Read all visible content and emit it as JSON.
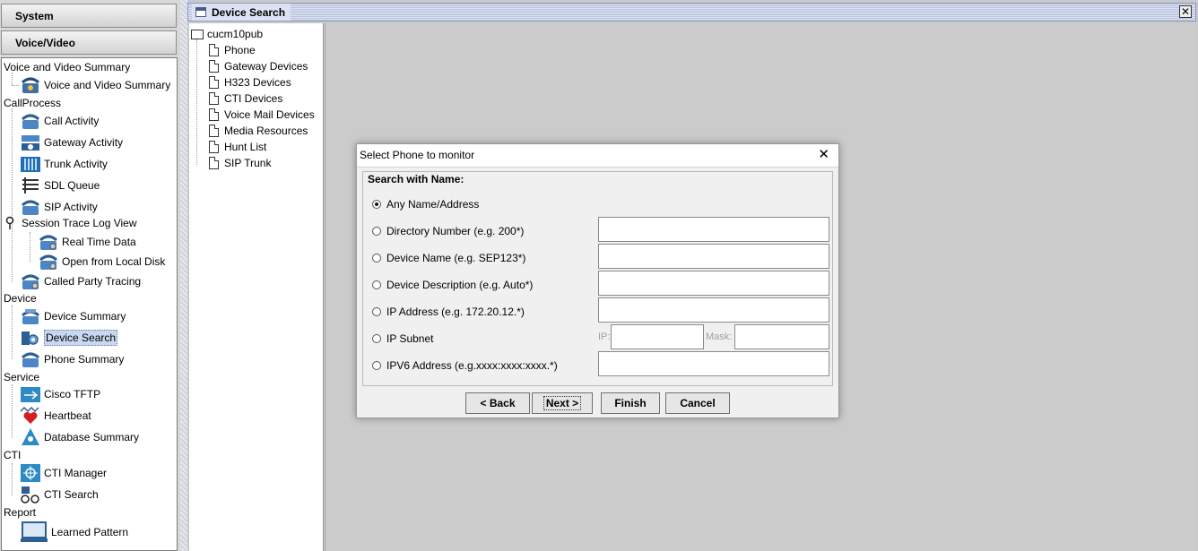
{
  "nav": {
    "system_label": "System",
    "voice_video_label": "Voice/Video"
  },
  "tree": {
    "sections": {
      "voice_video_summary": "Voice and Video Summary",
      "callprocess": "CallProcess",
      "device": "Device",
      "service": "Service",
      "cti": "CTI",
      "report": "Report"
    },
    "items": {
      "voice_video_summary": "Voice and Video Summary",
      "call_activity": "Call Activity",
      "gateway_activity": "Gateway Activity",
      "trunk_activity": "Trunk Activity",
      "sdl_queue": "SDL Queue",
      "sip_activity": "SIP Activity",
      "session_trace": "Session Trace Log View",
      "real_time_data": "Real Time Data",
      "open_local_disk": "Open from Local Disk",
      "called_party_tracing": "Called Party Tracing",
      "device_summary": "Device Summary",
      "device_search": "Device Search",
      "phone_summary": "Phone Summary",
      "cisco_tftp": "Cisco TFTP",
      "heartbeat": "Heartbeat",
      "database_summary": "Database Summary",
      "cti_manager": "CTI Manager",
      "cti_search": "CTI Search",
      "learned_pattern": "Learned Pattern"
    }
  },
  "frame": {
    "title": "Device Search",
    "close": "✕"
  },
  "device_tree": {
    "root": "cucm10pub",
    "items": [
      "Phone",
      "Gateway Devices",
      "H323 Devices",
      "CTI Devices",
      "Voice Mail Devices",
      "Media Resources",
      "Hunt List",
      "SIP Trunk"
    ]
  },
  "dialog": {
    "title": "Select Phone to monitor",
    "close": "✕",
    "group_title": "Search with Name:",
    "options": {
      "any": "Any Name/Address",
      "dn": "Directory Number (e.g. 200*)",
      "device_name": "Device Name (e.g. SEP123*)",
      "device_desc": "Device Description (e.g. Auto*)",
      "ip": "IP Address (e.g. 172.20.12.*)",
      "subnet": "IP Subnet",
      "ipv6": "IPV6 Address (e.g.xxxx:xxxx:xxxx.*)"
    },
    "selected_option": "Any Name/Address",
    "subnet_ip_label": "IP:",
    "subnet_mask_label": "Mask:",
    "buttons": {
      "back": "< Back",
      "next": "Next >",
      "finish": "Finish",
      "cancel": "Cancel"
    }
  },
  "colors": {
    "selection": "#c8d8f0",
    "frame_title": "#dde2f2"
  },
  "icons": {
    "voice_summary": "phone-gear-icon",
    "call_activity": "phone-icon",
    "gateway": "gateway-icon",
    "trunk": "trunk-icon",
    "sdl": "queue-icon",
    "sip": "phone-icon",
    "session_trace": "pin-icon",
    "device_summary": "phone-stack-icon",
    "device_search": "phone-search-icon",
    "tftp": "tftp-icon",
    "heartbeat": "heart-icon",
    "database": "database-icon",
    "cti_manager": "cti-manager-icon",
    "cti_search": "binoculars-icon",
    "learned_pattern": "monitor-icon"
  }
}
